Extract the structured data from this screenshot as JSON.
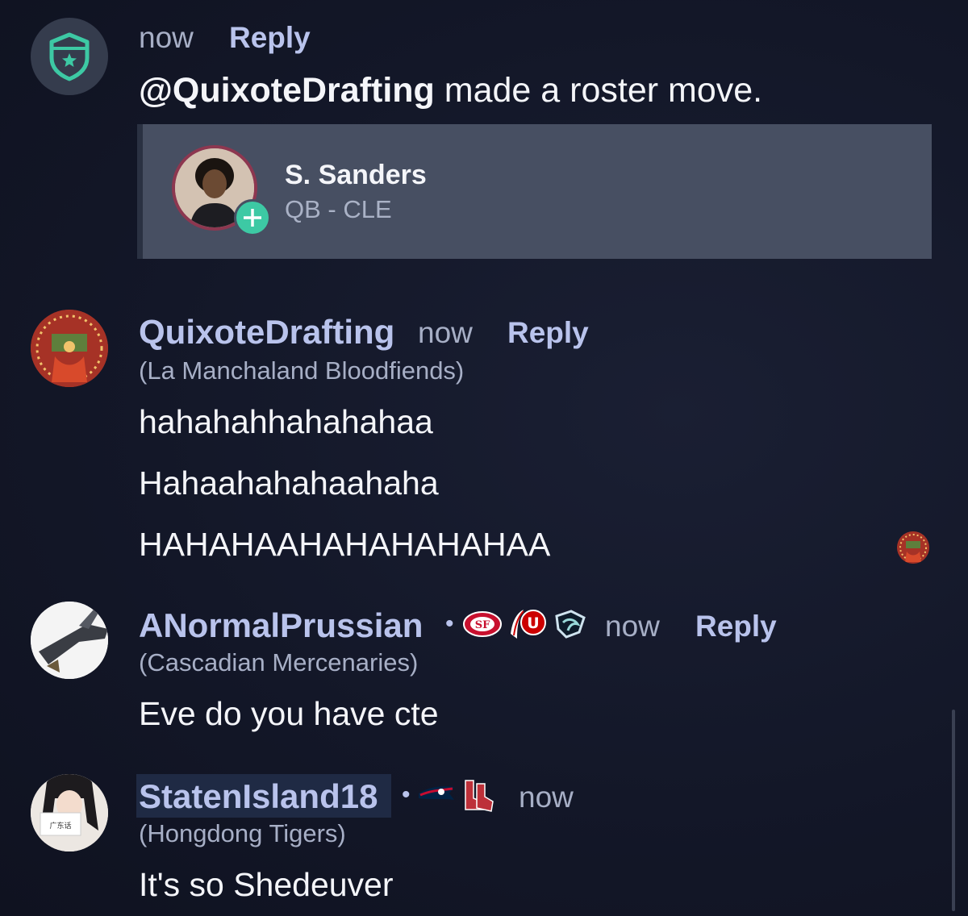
{
  "system_post": {
    "icon": "shield-star-icon",
    "time": "now",
    "reply_label": "Reply",
    "mention": "@QuixoteDrafting",
    "text": "made a roster move.",
    "card": {
      "player_name": "S. Sanders",
      "player_pos": "QB - CLE",
      "action_icon": "plus-icon"
    }
  },
  "comments": [
    {
      "username": "QuixoteDrafting",
      "team": "(La Manchaland Bloodfiends)",
      "time": "now",
      "reply_label": "Reply",
      "lines": [
        "hahahahhahahahaa",
        "Hahaahahahaahaha",
        "HAHAHAAHAHAHAHAHAA"
      ]
    },
    {
      "username": "ANormalPrussian",
      "team": "(Cascadian Mercenaries)",
      "time": "now",
      "reply_label": "Reply",
      "badges": [
        "49ers-logo",
        "utah-utes-logo",
        "seattle-kraken-logo"
      ],
      "lines": [
        "Eve do you have cte"
      ]
    },
    {
      "username": "StatenIsland18",
      "team": "(Hongdong Tigers)",
      "time": "now",
      "badges": [
        "patriots-logo",
        "red-sox-logo"
      ],
      "lines": [
        "It's so Shedeuver"
      ]
    }
  ],
  "colors": {
    "background": "#131728",
    "card_bg": "#474f62",
    "accent_green": "#3dc9a4",
    "username": "#b9c3ec",
    "muted": "#a7afc6"
  }
}
